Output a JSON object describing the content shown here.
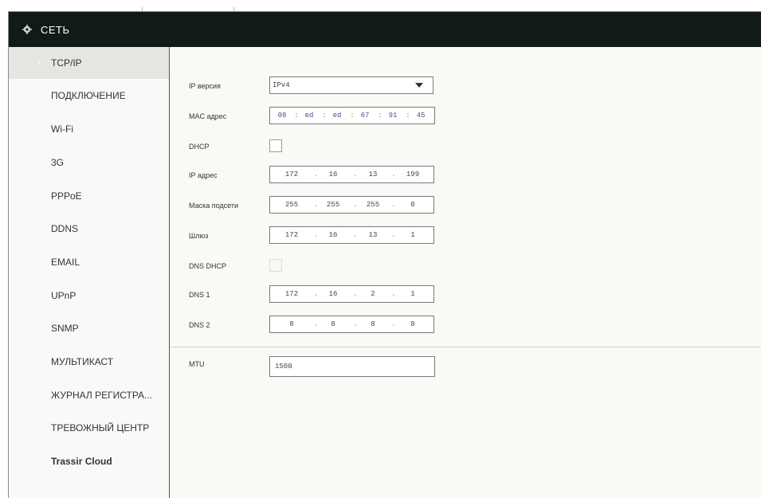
{
  "header": {
    "title": "СЕТЬ",
    "icon": "network-gear-icon"
  },
  "sidebar": {
    "items": [
      {
        "label": "TCP/IP",
        "active": true
      },
      {
        "label": "ПОДКЛЮЧЕНИЕ"
      },
      {
        "label": "Wi-Fi"
      },
      {
        "label": "3G"
      },
      {
        "label": "PPPoE"
      },
      {
        "label": "DDNS"
      },
      {
        "label": "EMAIL"
      },
      {
        "label": "UPnP"
      },
      {
        "label": "SNMP"
      },
      {
        "label": "МУЛЬТИКАСТ"
      },
      {
        "label": "ЖУРНАЛ РЕГИСТРА..."
      },
      {
        "label": "ТРЕВОЖНЫЙ ЦЕНТР"
      },
      {
        "label": "Trassir Cloud"
      }
    ]
  },
  "form": {
    "ip_version": {
      "label": "IP версия",
      "value": "IPv4"
    },
    "mac": {
      "label": "MAC адрес",
      "parts": [
        "08",
        "ed",
        "ed",
        "67",
        "91",
        "45"
      ]
    },
    "dhcp": {
      "label": "DHCP",
      "checked": false
    },
    "ip": {
      "label": "IP адрес",
      "parts": [
        "172",
        "16",
        "13",
        "199"
      ]
    },
    "mask": {
      "label": "Маска подсети",
      "parts": [
        "255",
        "255",
        "255",
        "0"
      ]
    },
    "gateway": {
      "label": "Шлюз",
      "parts": [
        "172",
        "16",
        "13",
        "1"
      ]
    },
    "dns_dhcp": {
      "label": "DNS DHCP",
      "checked": false,
      "disabled": true
    },
    "dns1": {
      "label": "DNS 1",
      "parts": [
        "172",
        "16",
        "2",
        "1"
      ]
    },
    "dns2": {
      "label": "DNS 2",
      "parts": [
        "8",
        "8",
        "8",
        "8"
      ]
    },
    "mtu": {
      "label": "MTU",
      "value": "1500"
    }
  },
  "colors": {
    "header_bg": "#111a17",
    "active_item_bg": "#e4e6e2",
    "content_bg": "#f8faf6"
  }
}
